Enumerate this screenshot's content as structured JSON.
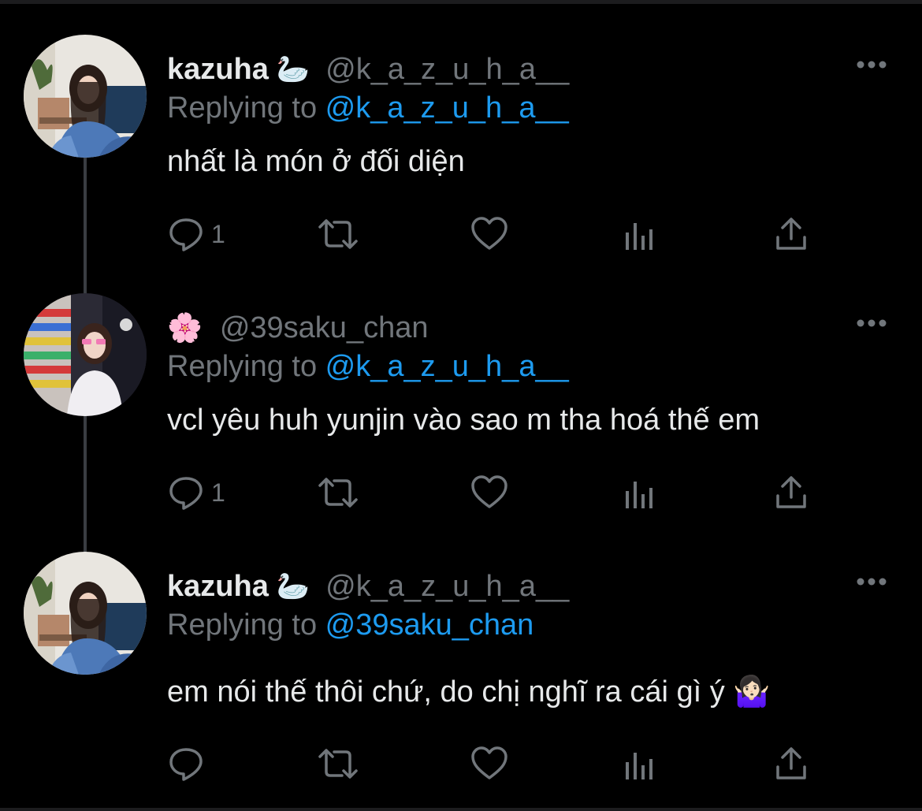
{
  "thread": {
    "tweets": [
      {
        "display_name": "kazuha",
        "name_emoji": "🦢",
        "handle": "@k_a_z_u_h_a__",
        "replying_label": "Replying to ",
        "replying_to": "@k_a_z_u_h_a__",
        "text": "nhất là món ở đối diện",
        "reply_count": "1"
      },
      {
        "display_name": "",
        "name_emoji": "🌸",
        "handle": "@39saku_chan",
        "replying_label": "Replying to ",
        "replying_to": "@k_a_z_u_h_a__",
        "text": "vcl yêu huh yunjin vào sao m tha hoá thế em",
        "reply_count": "1"
      },
      {
        "display_name": "kazuha",
        "name_emoji": "🦢",
        "handle": "@k_a_z_u_h_a__",
        "replying_label": "Replying to ",
        "replying_to": "@39saku_chan",
        "text": "em nói thế thôi chứ, do chị nghĩ ra cái gì ý 🤷🏻‍♀️",
        "reply_count": ""
      }
    ]
  },
  "icons": {
    "more": "more-horizontal-icon",
    "reply": "reply-icon",
    "retweet": "retweet-icon",
    "like": "heart-icon",
    "views": "views-chart-icon",
    "share": "share-icon"
  },
  "colors": {
    "background": "#000000",
    "text": "#e7e9ea",
    "secondary": "#71767b",
    "link": "#1d9bf0",
    "thread_line": "#3a3d42"
  }
}
